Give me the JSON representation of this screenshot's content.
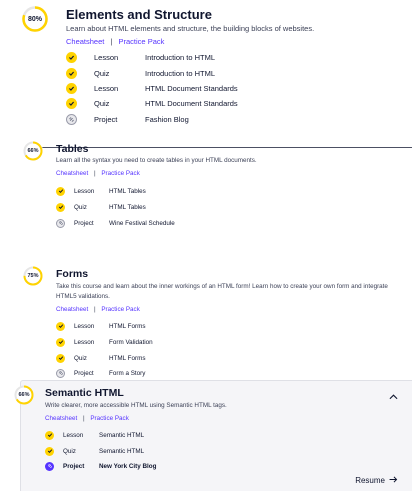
{
  "modules": [
    {
      "progress_label": "80%",
      "progress": 0.8,
      "title": "Elements and Structure",
      "description": "Learn about HTML elements and structure, the building blocks of websites.",
      "cheatsheet": "Cheatsheet",
      "separator": "|",
      "practice": "Practice Pack",
      "items": [
        {
          "kind": "Lesson",
          "name": "Introduction to HTML",
          "status": "done"
        },
        {
          "kind": "Quiz",
          "name": "Introduction to HTML",
          "status": "done"
        },
        {
          "kind": "Lesson",
          "name": "HTML Document Standards",
          "status": "done"
        },
        {
          "kind": "Quiz",
          "name": "HTML Document Standards",
          "status": "done"
        },
        {
          "kind": "Project",
          "name": "Fashion Blog",
          "status": "project"
        }
      ]
    },
    {
      "progress_label": "66%",
      "progress": 0.66,
      "title": "Tables",
      "description": "Learn all the syntax you need to create tables in your HTML documents.",
      "cheatsheet": "Cheatsheet",
      "separator": "|",
      "practice": "Practice Pack",
      "items": [
        {
          "kind": "Lesson",
          "name": "HTML Tables",
          "status": "done"
        },
        {
          "kind": "Quiz",
          "name": "HTML Tables",
          "status": "done"
        },
        {
          "kind": "Project",
          "name": "Wine Festival Schedule",
          "status": "project"
        }
      ]
    },
    {
      "progress_label": "75%",
      "progress": 0.75,
      "title": "Forms",
      "description_lines": [
        "Take this course and learn about the inner workings of an HTML form! Learn how to create your own form and integrate",
        "HTML5 validations."
      ],
      "cheatsheet": "Cheatsheet",
      "separator": "|",
      "practice": "Practice Pack",
      "items": [
        {
          "kind": "Lesson",
          "name": "HTML Forms",
          "status": "done"
        },
        {
          "kind": "Lesson",
          "name": "Form Validation",
          "status": "done"
        },
        {
          "kind": "Quiz",
          "name": "HTML Forms",
          "status": "done"
        },
        {
          "kind": "Project",
          "name": "Form a Story",
          "status": "project"
        }
      ]
    },
    {
      "progress_label": "66%",
      "progress": 0.66,
      "title": "Semantic HTML",
      "description": "Write clearer, more accessible HTML using Semantic HTML tags.",
      "cheatsheet": "Cheatsheet",
      "separator": "|",
      "practice": "Practice Pack",
      "items": [
        {
          "kind": "Lesson",
          "name": "Semantic HTML",
          "status": "done"
        },
        {
          "kind": "Quiz",
          "name": "Semantic HTML",
          "status": "done"
        },
        {
          "kind": "Project",
          "name": "New York City Blog",
          "status": "project-active"
        }
      ],
      "resume_label": "Resume",
      "resume_icon": "arrow-right-icon",
      "collapse_icon": "chevron-up-icon"
    }
  ],
  "colors": {
    "accent_yellow": "#ffd300",
    "link_purple": "#5533ff",
    "text_dark": "#10162f"
  }
}
